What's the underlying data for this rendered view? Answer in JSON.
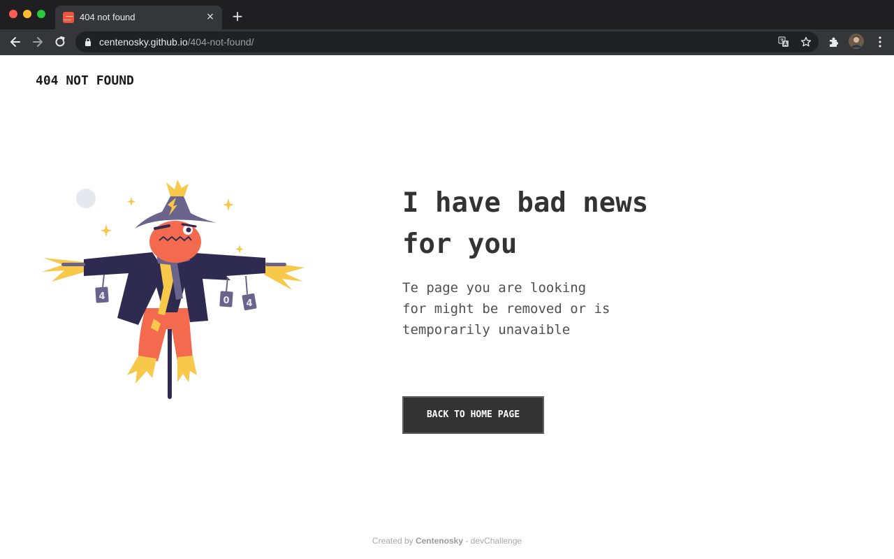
{
  "browser": {
    "tab_title": "404 not found",
    "tab_close": "×",
    "new_tab": "+",
    "url_host": "centenosky.github.io",
    "url_path": "/404-not-found/"
  },
  "page": {
    "brand": "404 NOT FOUND",
    "headline": "I have bad news for you",
    "subtext": "Te page you are looking for might be removed or is temporarily unavaible",
    "cta_label": "BACK TO HOME PAGE",
    "illustration": {
      "can_labels": [
        "4",
        "0",
        "4"
      ]
    },
    "footer": {
      "prefix": "Created by",
      "author": "Centenosky",
      "suffix": "- devChallenge"
    }
  },
  "colors": {
    "accent_dark": "#333333",
    "scarecrow_body": "#2f2a4f",
    "scarecrow_face": "#f36a4f",
    "straw": "#f8c84a"
  }
}
